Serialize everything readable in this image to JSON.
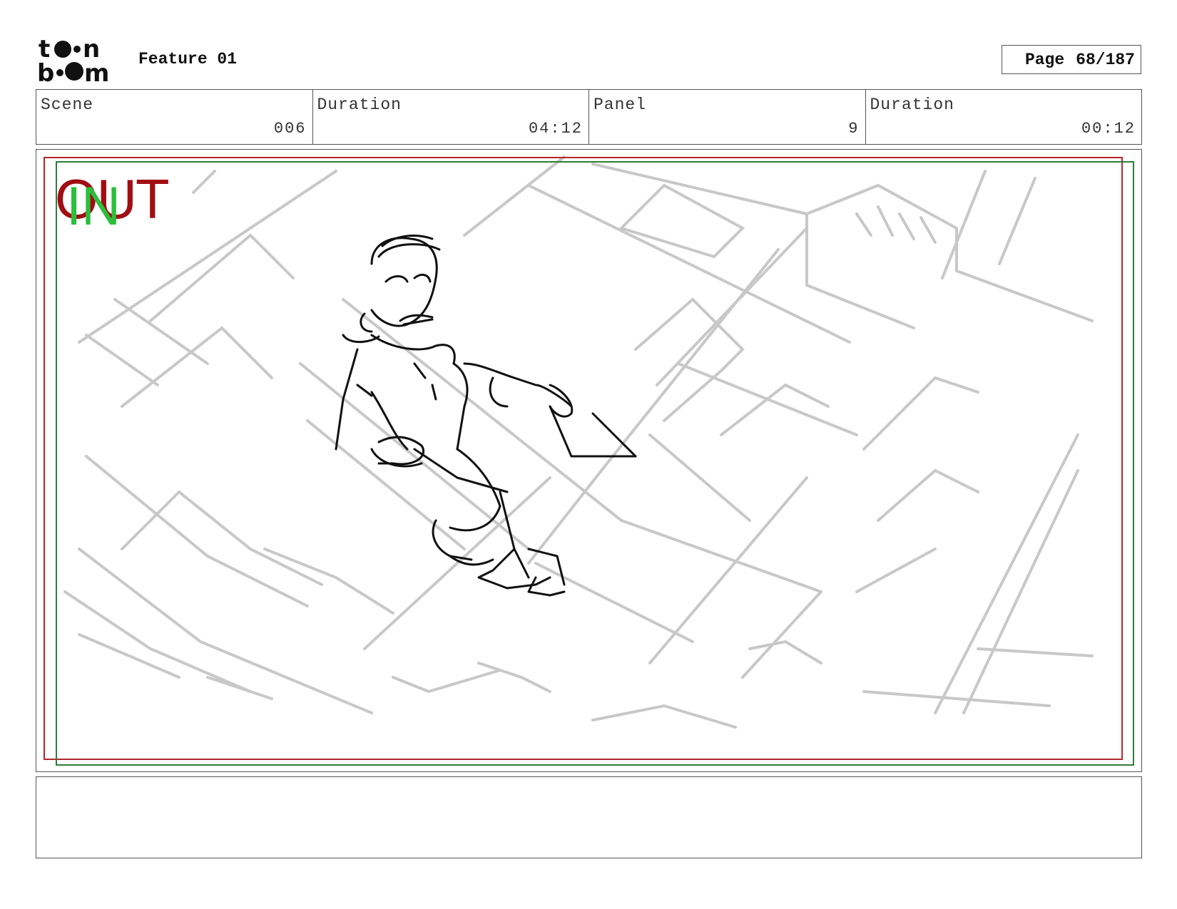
{
  "header": {
    "logo_text": "toon boom",
    "project_title": "Feature 01",
    "page_label": "Page",
    "page_value": "68/187"
  },
  "info": {
    "scene_label": "Scene",
    "scene_value": "006",
    "scene_duration_label": "Duration",
    "scene_duration_value": "04:12",
    "panel_label": "Panel",
    "panel_value": "9",
    "panel_duration_label": "Duration",
    "panel_duration_value": "00:12"
  },
  "panel": {
    "out_label": "OUT",
    "in_label": "IN",
    "out_color": "#a10d12",
    "in_color": "#2bbf3b"
  },
  "notes": {
    "text": ""
  }
}
